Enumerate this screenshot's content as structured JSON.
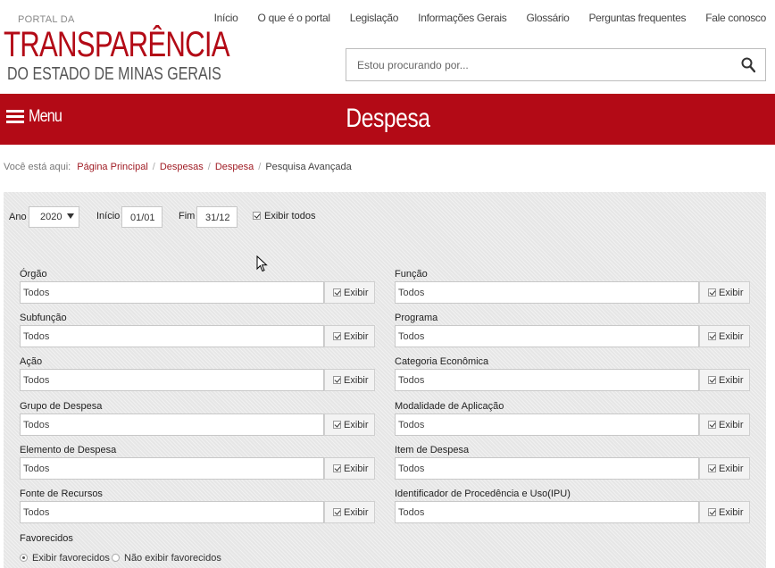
{
  "logo": {
    "line1": "PORTAL DA",
    "line2": "TRANSPARÊNCIA",
    "line3": "DO ESTADO DE MINAS GERAIS"
  },
  "topnav": [
    "Início",
    "O que é o portal",
    "Legislação",
    "Informações Gerais",
    "Glossário",
    "Perguntas frequentes",
    "Fale conosco"
  ],
  "search": {
    "placeholder": "Estou procurando por...",
    "icon": "search-icon"
  },
  "band": {
    "menu_label": "Menu",
    "title": "Despesa"
  },
  "breadcrumb": {
    "prefix": "Você está aqui:",
    "links": [
      "Página Principal",
      "Despesas",
      "Despesa"
    ],
    "current": "Pesquisa Avançada"
  },
  "filters": {
    "ano_label": "Ano",
    "ano_value": "2020",
    "inicio_label": "Início",
    "inicio_value": "01/01",
    "fim_label": "Fim",
    "fim_value": "31/12",
    "exibir_todos": "Exibir todos"
  },
  "fields_left": [
    {
      "label": "Órgão",
      "value": "Todos",
      "button": "Exibir"
    },
    {
      "label": "Subfunção",
      "value": "Todos",
      "button": "Exibir"
    },
    {
      "label": "Ação",
      "value": "Todos",
      "button": "Exibir"
    },
    {
      "label": "Grupo de Despesa",
      "value": "Todos",
      "button": "Exibir"
    },
    {
      "label": "Elemento de Despesa",
      "value": "Todos",
      "button": "Exibir"
    },
    {
      "label": "Fonte de Recursos",
      "value": "Todos",
      "button": "Exibir"
    }
  ],
  "fields_right": [
    {
      "label": "Função",
      "value": "Todos",
      "button": "Exibir"
    },
    {
      "label": "Programa",
      "value": "Todos",
      "button": "Exibir"
    },
    {
      "label": "Categoria Econômica",
      "value": "Todos",
      "button": "Exibir"
    },
    {
      "label": "Modalidade de Aplicação",
      "value": "Todos",
      "button": "Exibir"
    },
    {
      "label": "Item de Despesa",
      "value": "Todos",
      "button": "Exibir"
    },
    {
      "label": "Identificador de Procedência e Uso(IPU)",
      "value": "Todos",
      "button": "Exibir"
    }
  ],
  "favorecidos": {
    "label": "Favorecidos",
    "options": [
      "Exibir favorecidos",
      "Não exibir favorecidos"
    ],
    "selected": "Exibir favorecidos"
  },
  "colors": {
    "brand_red": "#b30a16",
    "link": "#a01c24",
    "panel_bg": "#e6e6e6"
  }
}
